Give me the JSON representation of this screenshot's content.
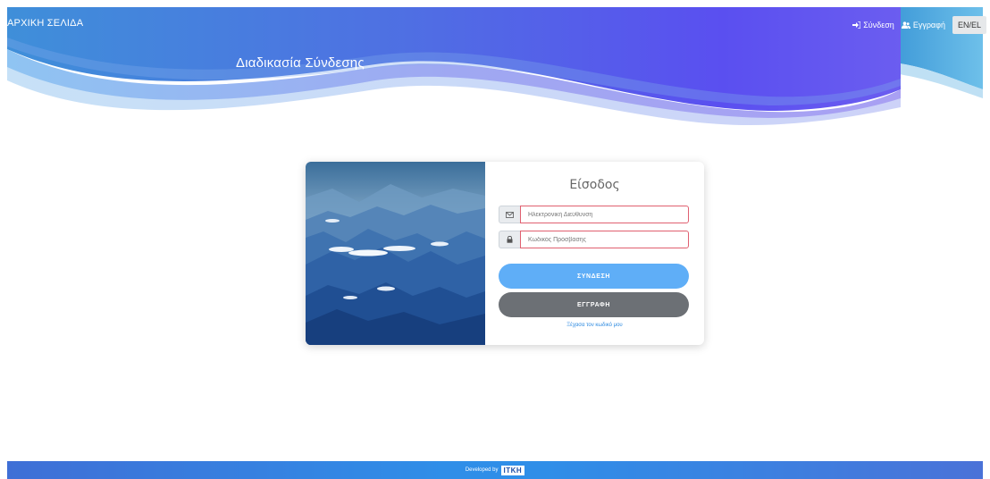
{
  "header": {
    "brand": "ΑΡΧΙΚΗ ΣΕΛΙΔΑ",
    "login_link": "Σύνδεση",
    "register_link": "Εγγραφή",
    "language": "EN/EL",
    "page_title": "Διαδικασία Σύνδεσης"
  },
  "login_form": {
    "title": "Είσοδος",
    "email_placeholder": "Ηλεκτρονική Διεύθυνση",
    "password_placeholder": "Κωδικός Πρόσβασης",
    "login_button": "ΣΥΝΔΕΣΗ",
    "register_button": "ΕΓΓΡΑΦΗ",
    "forgot_password": "Ξέχασα τον κωδικό μου"
  },
  "footer": {
    "developed_by": "Developed by",
    "logo_text": "ΙΤΚΗ"
  },
  "colors": {
    "login_button": "#5faef7",
    "register_button": "#6c7075",
    "footer": "#2f8ee8",
    "input_border": "#e06070"
  }
}
